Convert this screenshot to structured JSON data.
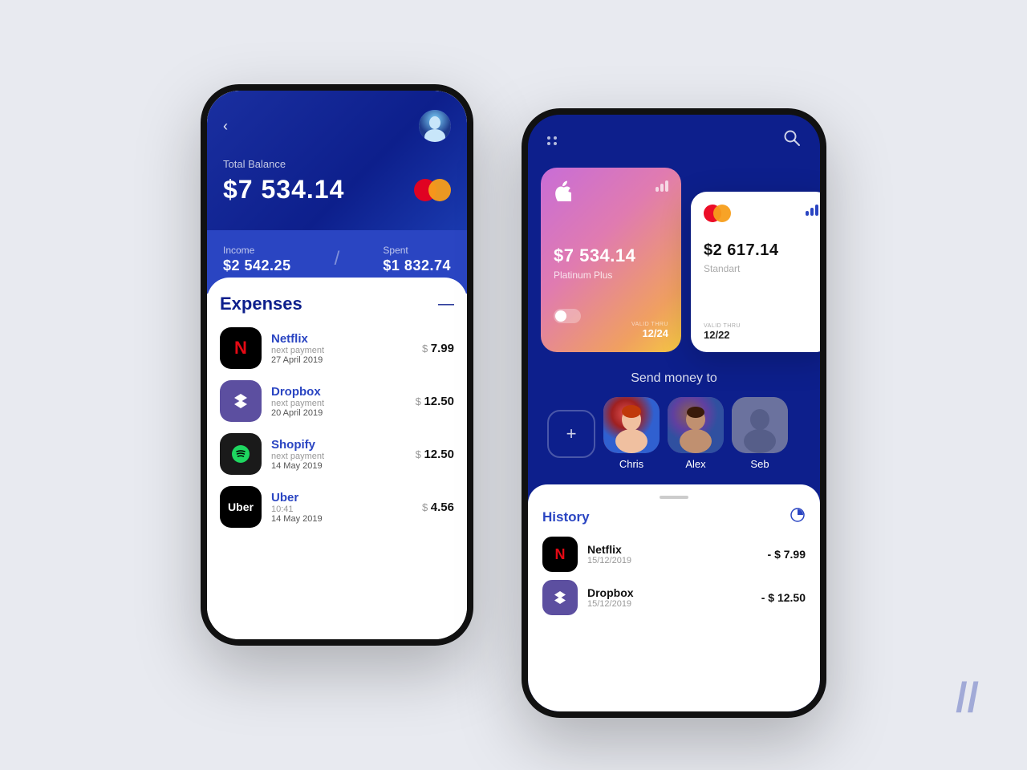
{
  "background_color": "#e8eaf0",
  "phone1": {
    "total_balance_label": "Total Balance",
    "total_balance_amount": "$7 534.14",
    "income_label": "Income",
    "income_amount": "$2 542.25",
    "spent_label": "Spent",
    "spent_amount": "$1 832.74",
    "expenses_title": "Expenses",
    "expenses": [
      {
        "name": "Netflix",
        "label": "next payment",
        "date": "27 April 2019",
        "amount": "$ 7.99",
        "icon": "N",
        "icon_type": "netflix"
      },
      {
        "name": "Dropbox",
        "label": "next payment",
        "date": "20 April 2019",
        "amount": "$ 12.50",
        "icon": "◆",
        "icon_type": "dropbox"
      },
      {
        "name": "Shopify",
        "label": "next payment",
        "date": "14 May 2019",
        "amount": "$ 12.50",
        "icon": "♪",
        "icon_type": "shopify"
      },
      {
        "name": "Uber",
        "label": "10:41",
        "date": "14 May 2019",
        "amount": "$ 4.56",
        "icon": "Uber",
        "icon_type": "uber"
      }
    ]
  },
  "phone2": {
    "cards": [
      {
        "type": "apple",
        "amount": "$7 534.14",
        "card_type": "Platinum Plus",
        "valid_thru_label": "VALID THRU",
        "valid_thru": "12/24"
      },
      {
        "type": "mastercard",
        "amount": "$2 617.14",
        "card_type": "Standart",
        "valid_thru_label": "VALID THRU",
        "valid_thru": "12/22"
      }
    ],
    "send_money_title": "Send money to",
    "contacts": [
      {
        "name": "Chris"
      },
      {
        "name": "Alex"
      },
      {
        "name": "Seb"
      }
    ],
    "history_title": "History",
    "history_items": [
      {
        "name": "Netflix",
        "date": "15/12/2019",
        "amount": "- $ 7.99",
        "icon_type": "netflix"
      },
      {
        "name": "Dropbox",
        "date": "15/12/2019",
        "amount": "- $ 12.50",
        "icon_type": "dropbox"
      }
    ]
  },
  "brand_slash": "//"
}
